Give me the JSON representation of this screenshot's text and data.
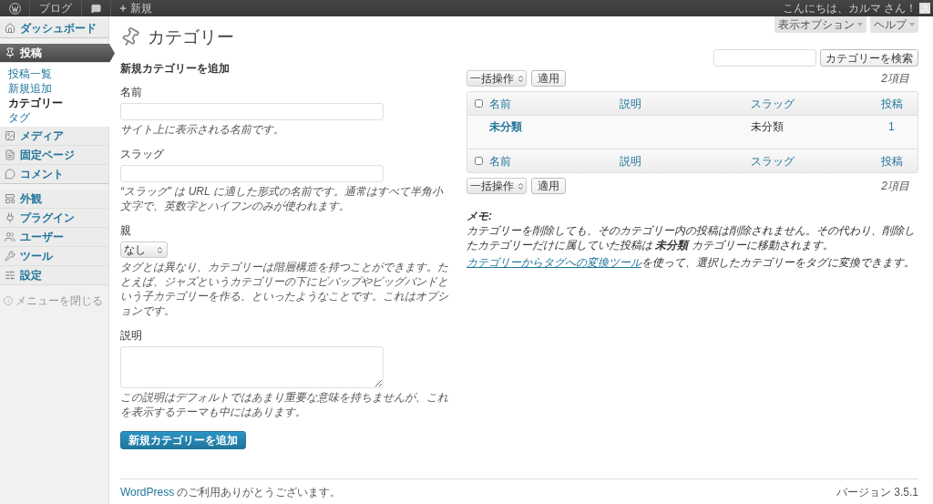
{
  "admin_bar": {
    "site": "ブログ",
    "new_label": "新規",
    "greeting": "こんにちは、カルマ さん！"
  },
  "screen_tabs": [
    "表示オプション",
    "ヘルプ"
  ],
  "sidebar": {
    "items": [
      {
        "label": "ダッシュボード",
        "selected": false,
        "group_end": true
      },
      {
        "label": "投稿",
        "selected": true,
        "children": [
          {
            "label": "投稿一覧",
            "selected": false
          },
          {
            "label": "新規追加",
            "selected": false
          },
          {
            "label": "カテゴリー",
            "selected": true
          },
          {
            "label": "タグ",
            "selected": false
          }
        ]
      },
      {
        "label": "メディア",
        "selected": false
      },
      {
        "label": "固定ページ",
        "selected": false
      },
      {
        "label": "コメント",
        "selected": false,
        "group_end": true
      },
      {
        "label": "外観",
        "selected": false
      },
      {
        "label": "プラグイン",
        "selected": false
      },
      {
        "label": "ユーザー",
        "selected": false
      },
      {
        "label": "ツール",
        "selected": false
      },
      {
        "label": "設定",
        "selected": false
      }
    ],
    "collapse": "メニューを閉じる"
  },
  "page_title": "カテゴリー",
  "form": {
    "heading": "新規カテゴリーを追加",
    "fields": [
      {
        "kind": "text",
        "label": "名前",
        "hint": "サイト上に表示される名前です。"
      },
      {
        "kind": "text",
        "label": "スラッグ",
        "hint": "“スラッグ” は URL に適した形式の名前です。通常はすべて半角小文字で、英数字とハイフンのみが使われます。"
      },
      {
        "kind": "select",
        "label": "親",
        "value": "なし",
        "hint": "タグとは異なり、カテゴリーは階層構造を持つことができます。たとえば、ジャズというカテゴリーの下にビバップやビッグバンドという子カテゴリーを作る、といったようなことです。これはオプションです。"
      },
      {
        "kind": "textarea",
        "label": "説明",
        "hint": "この説明はデフォルトではあまり重要な意味を持ちませんが、これを表示するテーマも中にはあります。"
      }
    ],
    "submit": "新規カテゴリーを追加"
  },
  "search": {
    "button": "カテゴリーを検索"
  },
  "table": {
    "bulk_top": {
      "select": "一括操作",
      "apply": "適用",
      "count": "2項目"
    },
    "header": {
      "checked": false,
      "columns": [
        "名前",
        "説明",
        "スラッグ",
        "投稿"
      ]
    },
    "rows": [
      {
        "name": "未分類",
        "slug": "未分類",
        "count": "1"
      }
    ],
    "footer": {
      "checked": false,
      "columns": [
        "名前",
        "説明",
        "スラッグ",
        "投稿"
      ]
    },
    "bulk_bottom": {
      "select": "一括操作",
      "apply": "適用",
      "count": "2項目"
    }
  },
  "note": {
    "title": "メモ:",
    "text": "カテゴリーを削除しても、そのカテゴリー内の投稿は削除されません。その代わり、削除したカテゴリーだけに属していた投稿は **未分類** カテゴリーに移動されます。",
    "link": "カテゴリーからタグへの変換ツール",
    "link_suffix": "を使って、選択したカテゴリーをタグに変換できます。"
  },
  "footer": {
    "link": "WordPress",
    "thanks": "のご利用ありがとうございます。",
    "version": "バージョン 3.5.1"
  }
}
